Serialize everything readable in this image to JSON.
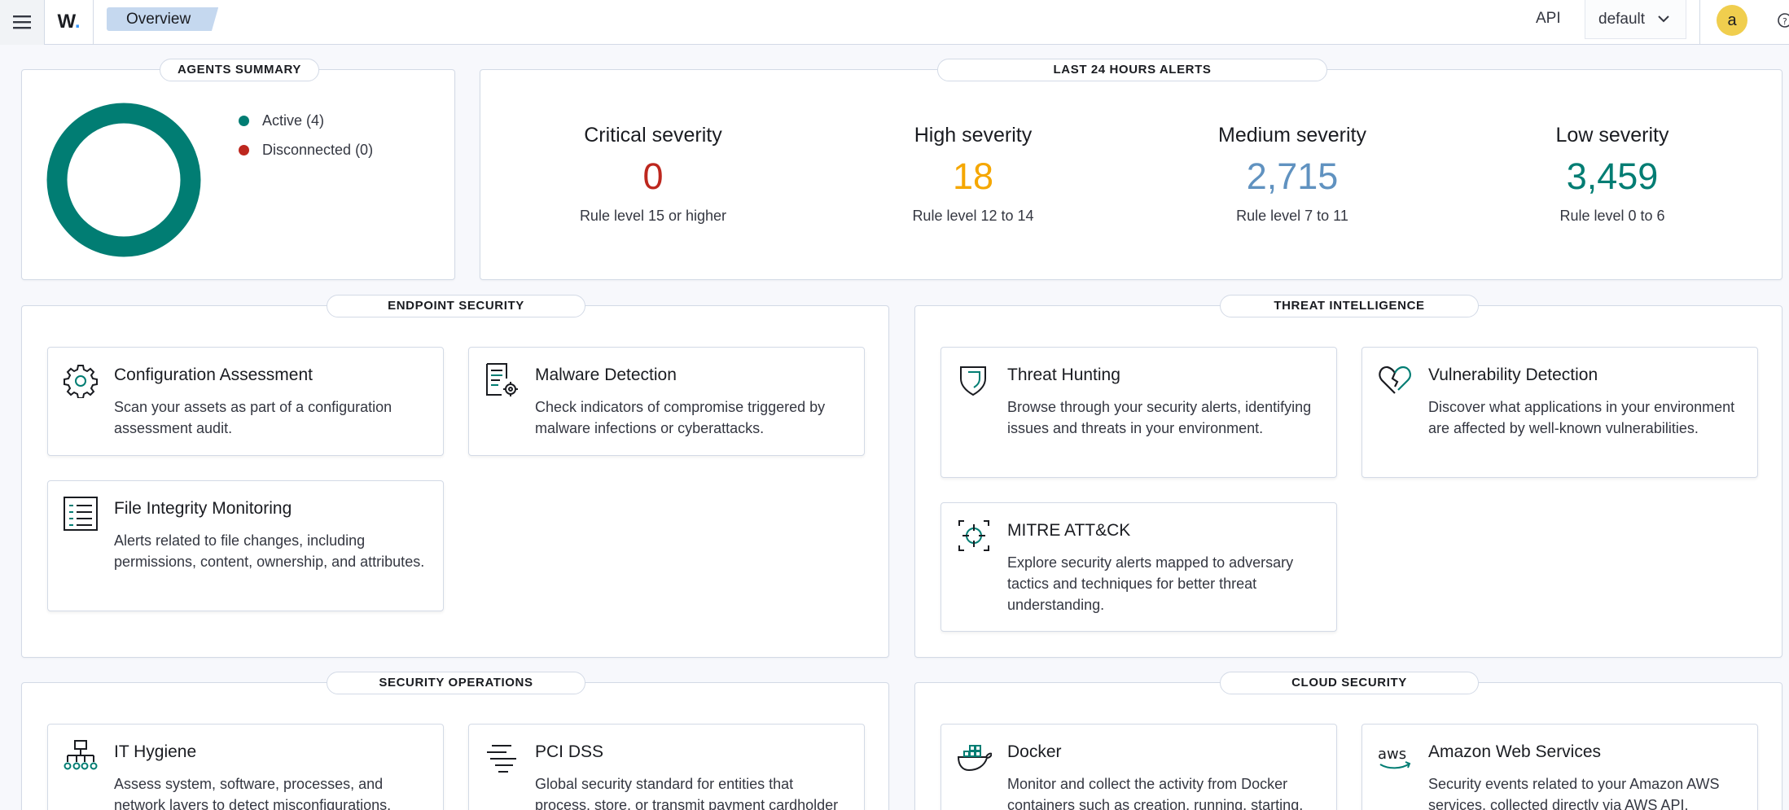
{
  "header": {
    "logo_text": "W",
    "logo_dot": ".",
    "breadcrumb": "Overview",
    "api_label": "API",
    "select_value": "default",
    "avatar_initial": "a"
  },
  "agents_summary": {
    "title": "AGENTS SUMMARY",
    "legend": [
      {
        "label": "Active (4)",
        "color": "#017d73"
      },
      {
        "label": "Disconnected (0)",
        "color": "#bd271e"
      }
    ],
    "donut": {
      "active": 4,
      "disconnected": 0
    }
  },
  "alerts": {
    "title": "LAST 24 HOURS ALERTS",
    "items": [
      {
        "label": "Critical severity",
        "value": "0",
        "desc": "Rule level 15 or higher",
        "color": "#bd271e"
      },
      {
        "label": "High severity",
        "value": "18",
        "desc": "Rule level 12 to 14",
        "color": "#f5a700"
      },
      {
        "label": "Medium severity",
        "value": "2,715",
        "desc": "Rule level 7 to 11",
        "color": "#6092c0"
      },
      {
        "label": "Low severity",
        "value": "3,459",
        "desc": "Rule level 0 to 6",
        "color": "#017d73"
      }
    ]
  },
  "endpoint_security": {
    "title": "ENDPOINT SECURITY",
    "cards": [
      {
        "title": "Configuration Assessment",
        "desc": "Scan your assets as part of a configuration assessment audit.",
        "icon": "gear-icon"
      },
      {
        "title": "Malware Detection",
        "desc": "Check indicators of compromise triggered by malware infections or cyberattacks.",
        "icon": "document-gear-icon"
      },
      {
        "title": "File Integrity Monitoring",
        "desc": "Alerts related to file changes, including permissions, content, ownership, and attributes.",
        "icon": "list-icon"
      }
    ]
  },
  "threat_intelligence": {
    "title": "THREAT INTELLIGENCE",
    "cards": [
      {
        "title": "Threat Hunting",
        "desc": "Browse through your security alerts, identifying issues and threats in your environment.",
        "icon": "shield-icon"
      },
      {
        "title": "Vulnerability Detection",
        "desc": "Discover what applications in your environment are affected by well-known vulnerabilities.",
        "icon": "broken-heart-icon"
      },
      {
        "title": "MITRE ATT&CK",
        "desc": "Explore security alerts mapped to adversary tactics and techniques for better threat understanding.",
        "icon": "crosshair-icon"
      }
    ]
  },
  "security_operations": {
    "title": "SECURITY OPERATIONS",
    "cards": [
      {
        "title": "IT Hygiene",
        "desc": "Assess system, software, processes, and network layers to detect misconfigurations.",
        "icon": "network-icon"
      },
      {
        "title": "PCI DSS",
        "desc": "Global security standard for entities that process, store, or transmit payment cardholder",
        "icon": "lines-icon"
      }
    ]
  },
  "cloud_security": {
    "title": "CLOUD SECURITY",
    "cards": [
      {
        "title": "Docker",
        "desc": "Monitor and collect the activity from Docker containers such as creation, running, starting,",
        "icon": "docker-icon"
      },
      {
        "title": "Amazon Web Services",
        "desc": "Security events related to your Amazon AWS services, collected directly via AWS API.",
        "icon": "aws-icon"
      }
    ]
  }
}
